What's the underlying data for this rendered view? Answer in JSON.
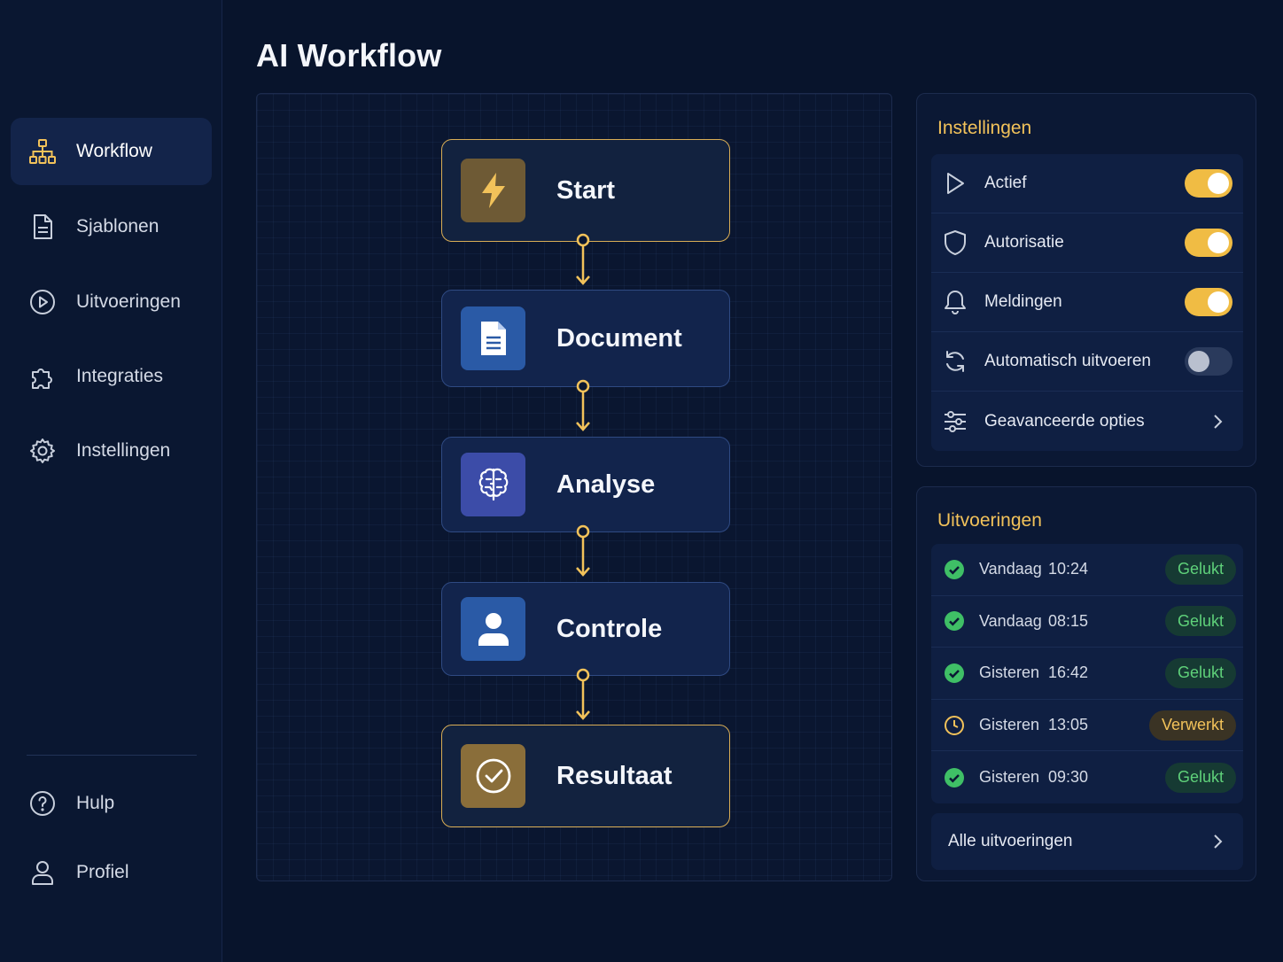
{
  "page": {
    "title": "AI Workflow"
  },
  "sidebar": {
    "items": [
      {
        "label": "Workflow",
        "icon": "hierarchy-icon",
        "active": true
      },
      {
        "label": "Sjablonen",
        "icon": "document-icon"
      },
      {
        "label": "Uitvoeringen",
        "icon": "play-circle-icon"
      },
      {
        "label": "Integraties",
        "icon": "puzzle-icon"
      },
      {
        "label": "Instellingen",
        "icon": "gear-icon"
      }
    ],
    "bottom": [
      {
        "label": "Hulp",
        "icon": "help-icon"
      },
      {
        "label": "Profiel",
        "icon": "user-icon"
      }
    ]
  },
  "workflow": {
    "nodes": [
      {
        "label": "Start",
        "icon": "lightning-icon"
      },
      {
        "label": "Document",
        "icon": "file-icon"
      },
      {
        "label": "Analyse",
        "icon": "brain-icon"
      },
      {
        "label": "Controle",
        "icon": "person-icon"
      },
      {
        "label": "Resultaat",
        "icon": "check-circle-icon"
      }
    ]
  },
  "settings": {
    "title": "Instellingen",
    "items": [
      {
        "label": "Actief",
        "icon": "play-icon",
        "enabled": true
      },
      {
        "label": "Autorisatie",
        "icon": "shield-icon",
        "enabled": true
      },
      {
        "label": "Meldingen",
        "icon": "bell-icon",
        "enabled": true
      },
      {
        "label": "Automatisch uitvoeren",
        "icon": "refresh-icon",
        "enabled": false
      },
      {
        "label": "Geavanceerde opties",
        "icon": "sliders-icon"
      }
    ]
  },
  "runs": {
    "title": "Uitvoeringen",
    "items": [
      {
        "day": "Vandaag",
        "time": "10:24",
        "status": "Gelukt"
      },
      {
        "day": "Vandaag",
        "time": "08:15",
        "status": "Gelukt"
      },
      {
        "day": "Gisteren",
        "time": "16:42",
        "status": "Gelukt"
      },
      {
        "day": "Gisteren",
        "time": "13:05",
        "status": "Verwerkt"
      },
      {
        "day": "Gisteren",
        "time": "09:30",
        "status": "Gelukt"
      }
    ],
    "all_label": "Alle uitvoeringen"
  },
  "colors": {
    "accent": "#f2c25a",
    "success": "#5fd17a",
    "background": "#08142c"
  }
}
